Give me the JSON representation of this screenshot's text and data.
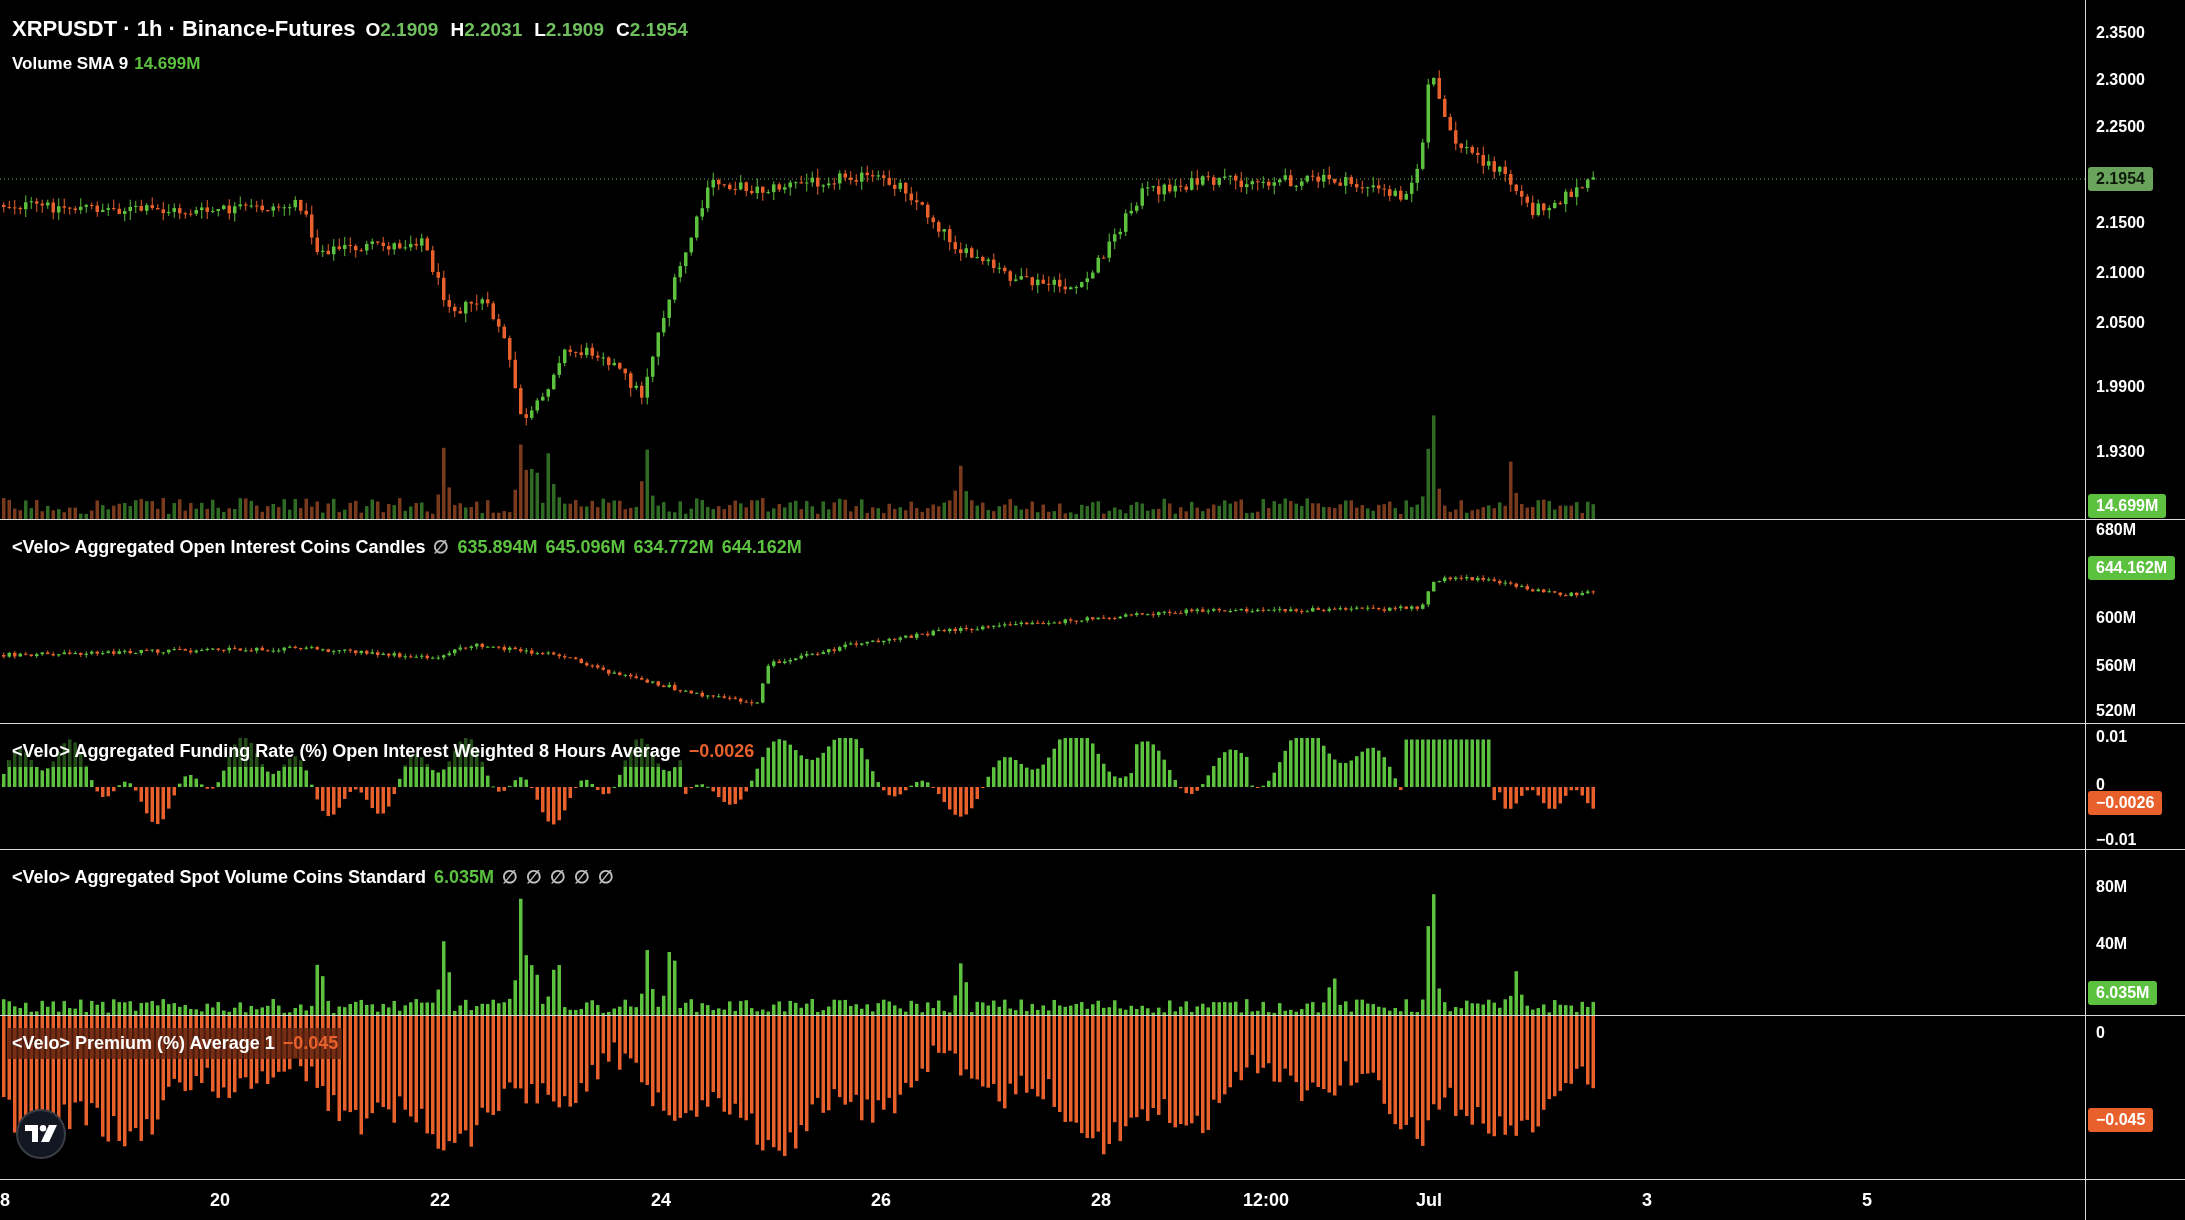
{
  "price_pane": {
    "kind": "price",
    "title": "XRPUSDT · 1h · Binance-Futures",
    "ohlc": [
      {
        "label": "O",
        "value": "2.1909"
      },
      {
        "label": "H",
        "value": "2.2031"
      },
      {
        "label": "L",
        "value": "2.1909"
      },
      {
        "label": "C",
        "value": "2.1954"
      }
    ],
    "volume_sma": {
      "label": "Volume SMA 9",
      "value": "14.699M"
    },
    "axis_labels": [
      "2.3500",
      "2.3000",
      "2.2500",
      "2.1500",
      "2.1000",
      "2.0500",
      "1.9900",
      "1.9300"
    ],
    "tags": [
      {
        "value": "2.1954",
        "color": "#6aa35c"
      },
      {
        "value": "14.699M",
        "color": "#5cc13f"
      }
    ]
  },
  "indicator_panes": [
    {
      "kind": "oi_candles",
      "title": "<Velo> Aggregated Open Interest Coins Candles",
      "values": [
        {
          "text": "∅",
          "color": "#bdbdbd"
        },
        {
          "text": "635.894M",
          "color": "#5cc13f"
        },
        {
          "text": "645.096M",
          "color": "#5cc13f"
        },
        {
          "text": "634.772M",
          "color": "#5cc13f"
        },
        {
          "text": "644.162M",
          "color": "#5cc13f"
        }
      ],
      "axis_labels": [
        "680M",
        "600M",
        "560M",
        "520M"
      ],
      "tags": [
        {
          "value": "644.162M",
          "color": "#5cc13f"
        }
      ]
    },
    {
      "kind": "funding",
      "title": "<Velo> Aggregated Funding Rate (%) Open Interest Weighted 8 Hours Average",
      "values": [
        {
          "text": "−0.0026",
          "color": "#e8612c"
        }
      ],
      "axis_labels": [
        "0.01",
        "0",
        "−0.01"
      ],
      "tags": [
        {
          "value": "−0.0026",
          "color": "#e8612c"
        }
      ]
    },
    {
      "kind": "spot_volume",
      "title": "<Velo> Aggregated Spot Volume Coins Standard",
      "values": [
        {
          "text": "6.035M",
          "color": "#5cc13f"
        },
        {
          "text": "∅",
          "color": "#bdbdbd"
        },
        {
          "text": "∅",
          "color": "#bdbdbd"
        },
        {
          "text": "∅",
          "color": "#bdbdbd"
        },
        {
          "text": "∅",
          "color": "#bdbdbd"
        },
        {
          "text": "∅",
          "color": "#bdbdbd"
        }
      ],
      "axis_labels": [
        "80M",
        "40M"
      ],
      "tags": [
        {
          "value": "6.035M",
          "color": "#5cc13f"
        }
      ]
    },
    {
      "kind": "premium",
      "title": "<Velo> Premium (%) Average 1",
      "values": [
        {
          "text": "−0.045",
          "color": "#e8612c"
        }
      ],
      "axis_labels": [
        "0"
      ],
      "tags": [
        {
          "value": "−0.045",
          "color": "#e8612c"
        }
      ]
    }
  ],
  "time_axis": [
    "8",
    "20",
    "22",
    "24",
    "26",
    "28",
    "12:00",
    "Jul",
    "3",
    "5"
  ]
}
